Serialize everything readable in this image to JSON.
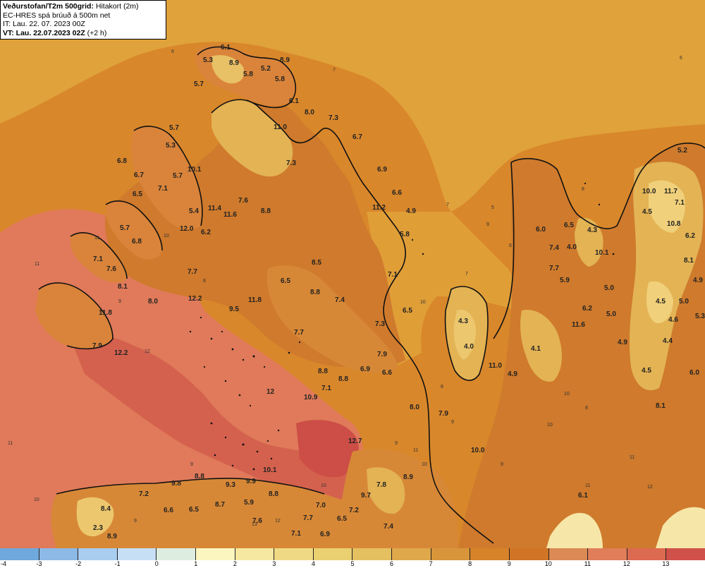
{
  "header": {
    "source": "Veðurstofan/T2m 500grid:",
    "product": "Hitakort (2m)",
    "model": "EC-HRES spá brúuð á 500m net",
    "init_time": "IT: Lau. 22. 07. 2023 00Z",
    "valid_prefix": "VT: Lau. 22.07.2023 02Z",
    "valid_offset": "(+2 h)"
  },
  "legend": {
    "ticks": [
      "-4",
      "-3",
      "-2",
      "-1",
      "0",
      "1",
      "2",
      "3",
      "4",
      "5",
      "6",
      "7",
      "8",
      "9",
      "10",
      "11",
      "12",
      "13"
    ],
    "colors": [
      "#6fa8dc",
      "#8cb9e6",
      "#a9cdef",
      "#c6dff5",
      "#ddeee0",
      "#fbf6c0",
      "#f6e8a0",
      "#f0d985",
      "#ead071",
      "#e5c061",
      "#dfa84b",
      "#d8953a",
      "#d6832a",
      "#d27426",
      "#db8a55",
      "#e07e5a",
      "#dc6a50",
      "#d0514a"
    ]
  },
  "map": {
    "colors": {
      "sea_outer": "#e0a23a",
      "sea_inner": "#d9872b",
      "warm_zone": "#e07a5a",
      "hot_zone": "#d4614e",
      "land": "#cf7a2c",
      "highland": "#e3b354",
      "peaks": "#f0d07a",
      "snow": "#f6e6a8",
      "coast": "#111111"
    },
    "temp_labels": [
      {
        "t": "5.3"
      },
      {
        "t": "6.1"
      },
      {
        "t": "8.9"
      },
      {
        "t": "5.2"
      },
      {
        "t": "8.9"
      },
      {
        "t": "5.8"
      },
      {
        "t": "5.7"
      },
      {
        "t": "5.8"
      },
      {
        "t": "6.1"
      },
      {
        "t": "8.0"
      },
      {
        "t": "7.3"
      },
      {
        "t": "11.0"
      },
      {
        "t": "6.7"
      },
      {
        "t": "5.7"
      },
      {
        "t": "5.3"
      },
      {
        "t": "6.8"
      },
      {
        "t": "6.7"
      },
      {
        "t": "5.7"
      },
      {
        "t": "10.1"
      },
      {
        "t": "7.3"
      },
      {
        "t": "6.9"
      },
      {
        "t": "7.1"
      },
      {
        "t": "6.5"
      },
      {
        "t": "6.6"
      },
      {
        "t": "5.4"
      },
      {
        "t": "11.4"
      },
      {
        "t": "11.6"
      },
      {
        "t": "7.6"
      },
      {
        "t": "8.8"
      },
      {
        "t": "11.2"
      },
      {
        "t": "4.9"
      },
      {
        "t": "5.7"
      },
      {
        "t": "12.0"
      },
      {
        "t": "6.2"
      },
      {
        "t": "6.8"
      },
      {
        "t": "5.8"
      },
      {
        "t": "7.1"
      },
      {
        "t": "7.6"
      },
      {
        "t": "7.7"
      },
      {
        "t": "8.5"
      },
      {
        "t": "7.1"
      },
      {
        "t": "8.1"
      },
      {
        "t": "6.5"
      },
      {
        "t": "8.8"
      },
      {
        "t": "8.0"
      },
      {
        "t": "12.2"
      },
      {
        "t": "11.8"
      },
      {
        "t": "9.5"
      },
      {
        "t": "7.4"
      },
      {
        "t": "6.5"
      },
      {
        "t": "11.8"
      },
      {
        "t": "7.3"
      },
      {
        "t": "7.7"
      },
      {
        "t": "7.9"
      },
      {
        "t": "12.2"
      },
      {
        "t": "7.9"
      },
      {
        "t": "6.9"
      },
      {
        "t": "6.6"
      },
      {
        "t": "8.8"
      },
      {
        "t": "7.1"
      },
      {
        "t": "8.8"
      },
      {
        "t": "10.9"
      },
      {
        "t": "12"
      },
      {
        "t": "8.0"
      },
      {
        "t": "7.9"
      },
      {
        "t": "12.7"
      },
      {
        "t": "10.0"
      },
      {
        "t": "10.1"
      },
      {
        "t": "8.9"
      },
      {
        "t": "7.8"
      },
      {
        "t": "9.8"
      },
      {
        "t": "8.8"
      },
      {
        "t": "9.3"
      },
      {
        "t": "9.9"
      },
      {
        "t": "8.8"
      },
      {
        "t": "7.2"
      },
      {
        "t": "8.4"
      },
      {
        "t": "8.7"
      },
      {
        "t": "5.9"
      },
      {
        "t": "6.6"
      },
      {
        "t": "6.5"
      },
      {
        "t": "7.0"
      },
      {
        "t": "9.7"
      },
      {
        "t": "7.6"
      },
      {
        "t": "7.7"
      },
      {
        "t": "6.5"
      },
      {
        "t": "7.2"
      },
      {
        "t": "2.3"
      },
      {
        "t": "8.9"
      },
      {
        "t": "7.1"
      },
      {
        "t": "6.9"
      },
      {
        "t": "7.4"
      },
      {
        "t": "6.1"
      },
      {
        "t": "4.3"
      },
      {
        "t": "4.0"
      },
      {
        "t": "11.0"
      },
      {
        "t": "4.1"
      },
      {
        "t": "4.9"
      },
      {
        "t": "6.0"
      },
      {
        "t": "6.5"
      },
      {
        "t": "4.3"
      },
      {
        "t": "10.1"
      },
      {
        "t": "7.4"
      },
      {
        "t": "4.0"
      },
      {
        "t": "7.7"
      },
      {
        "t": "5.9"
      },
      {
        "t": "5.0"
      },
      {
        "t": "6.2"
      },
      {
        "t": "5.0"
      },
      {
        "t": "11.6"
      },
      {
        "t": "4.9"
      },
      {
        "t": "4.5"
      },
      {
        "t": "8.1"
      },
      {
        "t": "4.5"
      },
      {
        "t": "5.2"
      },
      {
        "t": "10.0"
      },
      {
        "t": "11.7"
      },
      {
        "t": "7.1"
      },
      {
        "t": "10.8"
      },
      {
        "t": "6.2"
      },
      {
        "t": "8.1"
      },
      {
        "t": "4.9"
      },
      {
        "t": "4.5"
      },
      {
        "t": "5.0"
      },
      {
        "t": "4.6"
      },
      {
        "t": "5.3"
      },
      {
        "t": "4.4"
      },
      {
        "t": "6.0"
      }
    ],
    "contour_labels": [
      {
        "t": "6"
      },
      {
        "t": "7"
      },
      {
        "t": "6"
      },
      {
        "t": "7"
      },
      {
        "t": "8"
      },
      {
        "t": "9"
      },
      {
        "t": "10"
      },
      {
        "t": "11"
      },
      {
        "t": "10"
      },
      {
        "t": "9"
      },
      {
        "t": "11"
      },
      {
        "t": "12"
      },
      {
        "t": "11"
      },
      {
        "t": "10"
      },
      {
        "t": "9"
      },
      {
        "t": "8"
      },
      {
        "t": "5"
      },
      {
        "t": "6"
      },
      {
        "t": "7"
      },
      {
        "t": "8"
      },
      {
        "t": "9"
      },
      {
        "t": "10"
      },
      {
        "t": "11"
      },
      {
        "t": "10"
      },
      {
        "t": "11"
      },
      {
        "t": "12"
      },
      {
        "t": "9"
      },
      {
        "t": "8"
      },
      {
        "t": "9"
      },
      {
        "t": "10"
      },
      {
        "t": "11"
      },
      {
        "t": "13"
      },
      {
        "t": "12"
      },
      {
        "t": "10"
      },
      {
        "t": "9"
      }
    ]
  }
}
